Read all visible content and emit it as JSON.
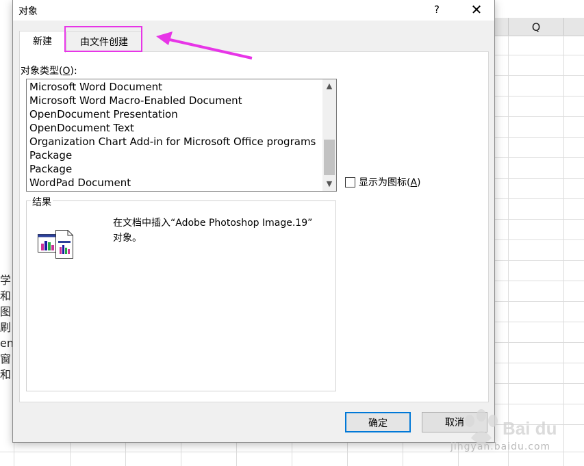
{
  "dialog": {
    "title": "对象",
    "help_label": "?",
    "close_label": "✕"
  },
  "tabs": [
    {
      "label": "新建"
    },
    {
      "label": "由文件创建"
    }
  ],
  "object_type": {
    "label_prefix": "对象类型(",
    "label_key": "O",
    "label_suffix": "):",
    "items": [
      "Microsoft Word Document",
      "Microsoft Word Macro-Enabled Document",
      "OpenDocument Presentation",
      "OpenDocument Text",
      "Organization Chart Add-in for Microsoft Office programs",
      "Package",
      "Package",
      "WordPad Document"
    ],
    "scroll_up_glyph": "▲",
    "scroll_down_glyph": "▼"
  },
  "display_as_icon": {
    "label_prefix": "显示为图标(",
    "label_key": "A",
    "label_suffix": ")",
    "checked": false
  },
  "result": {
    "legend": "结果",
    "description_line1": "在文档中插入“Adobe Photoshop Image.19”",
    "description_line2": "对象。"
  },
  "buttons": {
    "ok": "确定",
    "cancel": "取消"
  },
  "spreadsheet": {
    "column_header": "Q",
    "left_text": [
      "学",
      "和",
      "图",
      "刷",
      "ent",
      "窗",
      "和"
    ]
  },
  "watermark": {
    "text": "jingyan.baidu.com"
  },
  "colors": {
    "highlight": "#e735e7",
    "ok_border": "#0078d7"
  }
}
